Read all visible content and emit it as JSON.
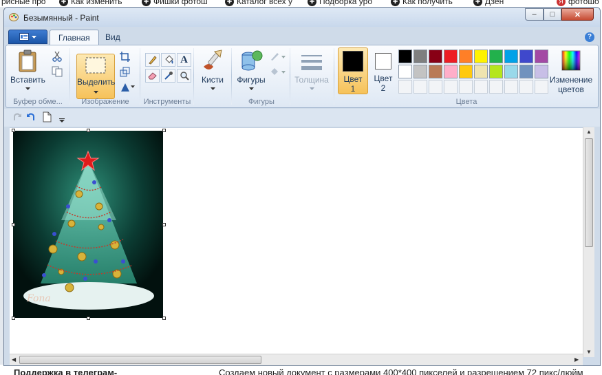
{
  "browser_bookmarks": [
    {
      "label": "рисные про",
      "icon": "none"
    },
    {
      "label": "Как изменить",
      "icon": "add-icon"
    },
    {
      "label": "Фишки фотош",
      "icon": "add-icon"
    },
    {
      "label": "Каталог всех у",
      "icon": "add-icon"
    },
    {
      "label": "Подборка уро",
      "icon": "add-icon"
    },
    {
      "label": "Как получить",
      "icon": "add-icon"
    },
    {
      "label": "Дзен",
      "icon": "add-icon"
    },
    {
      "label": "фотошо",
      "icon": "yandex-icon"
    }
  ],
  "background_page": {
    "left_text": "Поддержка в телеграм-",
    "right_text": "Создаем новый документ с размерами 400*400 пикселей и разрешением 72 пикс/дюйм"
  },
  "window": {
    "title": "Безымянный - Paint",
    "controls": {
      "minimize": "–",
      "maximize": "□",
      "close": "✕"
    }
  },
  "tabs": [
    {
      "label": "Главная",
      "active": true
    },
    {
      "label": "Вид",
      "active": false
    }
  ],
  "ribbon": {
    "clipboard": {
      "paste": "Вставить",
      "group": "Буфер обме..."
    },
    "image": {
      "select": "Выделить",
      "group": "Изображение"
    },
    "tools": {
      "group": "Инструменты"
    },
    "brushes": {
      "label": "Кисти"
    },
    "shapes": {
      "label": "Фигуры",
      "group": "Фигуры"
    },
    "thickness": {
      "label": "Толщина"
    },
    "colors": {
      "color1": "Цвет 1",
      "color1_line1": "Цвет",
      "color1_line2": "1",
      "color2_line1": "Цвет",
      "color2_line2": "2",
      "edit_line1": "Изменение",
      "edit_line2": "цветов",
      "group": "Цвета",
      "color1_value": "#000000",
      "color2_value": "#ffffff",
      "palette_row1": [
        "#000000",
        "#7f7f7f",
        "#880015",
        "#ed1c24",
        "#ff7f27",
        "#fff200",
        "#22b14c",
        "#00a2e8",
        "#3f48cc",
        "#a349a4"
      ],
      "palette_row2": [
        "#ffffff",
        "#c3c3c3",
        "#b97a57",
        "#ffaec9",
        "#ffc90e",
        "#efe4b0",
        "#b5e61d",
        "#99d9ea",
        "#7092be",
        "#c8bfe7"
      ]
    }
  },
  "canvas": {
    "signature": "Fona",
    "image_subject": "christmas-tree"
  }
}
